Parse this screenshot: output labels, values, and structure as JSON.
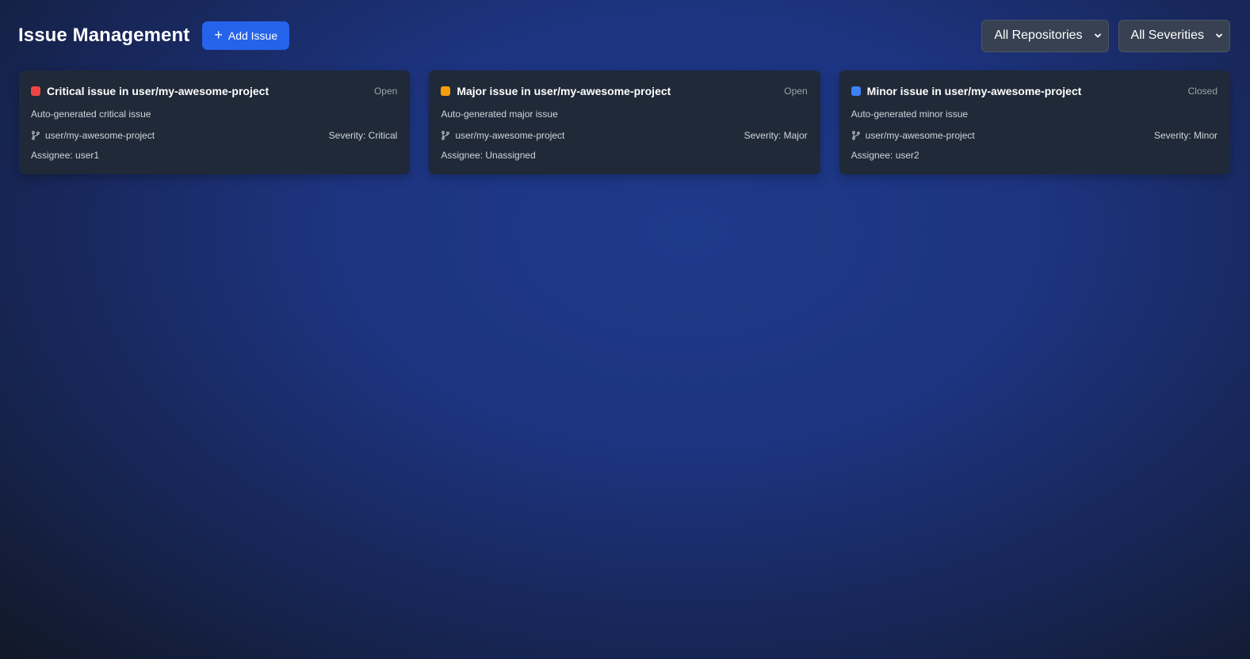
{
  "header": {
    "title": "Issue Management",
    "add_button_label": "Add Issue",
    "repo_filter": "All Repositories",
    "severity_filter": "All Severities"
  },
  "issues": [
    {
      "title": "Critical issue in user/my-awesome-project",
      "status": "Open",
      "description": "Auto-generated critical issue",
      "repository": "user/my-awesome-project",
      "severity": "Severity: Critical",
      "assignee": "Assignee: user1",
      "color": "#ef4444"
    },
    {
      "title": "Major issue in user/my-awesome-project",
      "status": "Open",
      "description": "Auto-generated major issue",
      "repository": "user/my-awesome-project",
      "severity": "Severity: Major",
      "assignee": "Assignee: Unassigned",
      "color": "#f59e0b"
    },
    {
      "title": "Minor issue in user/my-awesome-project",
      "status": "Closed",
      "description": "Auto-generated minor issue",
      "repository": "user/my-awesome-project",
      "severity": "Severity: Minor",
      "assignee": "Assignee: user2",
      "color": "#3b82f6"
    }
  ],
  "colors": {
    "accent": "#2563eb",
    "card_bg": "#1f2937"
  },
  "icons": [
    "plus-icon",
    "chevron-down-icon",
    "git-branch-icon"
  ]
}
